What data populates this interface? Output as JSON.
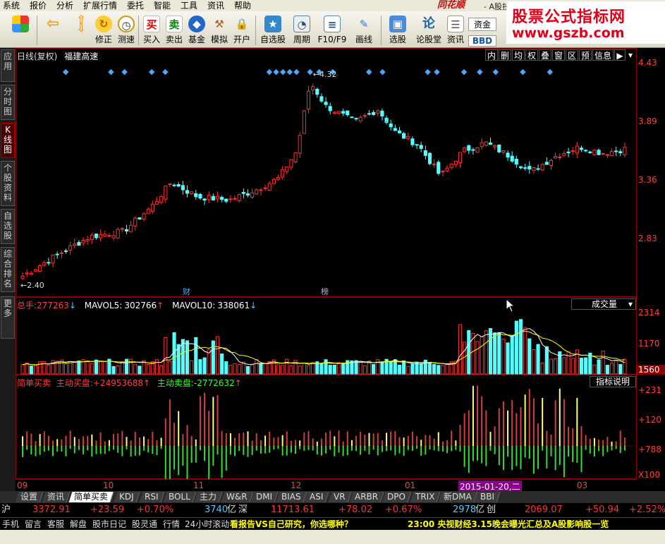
{
  "menu": [
    "系统",
    "报价",
    "分析",
    "扩展行情",
    "委托",
    "智能",
    "工具",
    "资讯",
    "帮助"
  ],
  "brand": "同花顺",
  "brand_sub": "- A股技",
  "watermark": {
    "line1": "股票公式指标网",
    "line2": "www.gszb.com"
  },
  "toolbar": [
    {
      "label": "",
      "icon": "grid-icon"
    },
    {
      "label": "",
      "icon": "back-arrow-icon"
    },
    {
      "label": "",
      "icon": "up-down-arrow-icon"
    },
    {
      "label": "修正",
      "icon": "refresh-icon"
    },
    {
      "label": "测速",
      "icon": "clock-icon"
    },
    {
      "label": "买入",
      "icon": "buy-icon",
      "glyph": "买"
    },
    {
      "label": "卖出",
      "icon": "sell-icon",
      "glyph": "卖"
    },
    {
      "label": "基金",
      "icon": "fund-icon"
    },
    {
      "label": "模拟",
      "icon": "hammer-icon"
    },
    {
      "label": "开户",
      "icon": "lock-icon"
    },
    {
      "label": "自选股",
      "icon": "star-icon"
    },
    {
      "label": "周期",
      "icon": "period-icon"
    },
    {
      "label": "F10/F9",
      "icon": "f10-icon"
    },
    {
      "label": "画线",
      "icon": "pencil-icon"
    },
    {
      "label": "选股",
      "icon": "screen-icon"
    },
    {
      "label": "论股堂",
      "icon": "forum-icon"
    },
    {
      "label": "资讯",
      "icon": "news-icon"
    },
    {
      "label": "资金",
      "icon": "fund-flow-icon"
    },
    {
      "label": "BBD",
      "icon": "bbd-icon"
    }
  ],
  "left_tabs": [
    "应用",
    "分时图",
    "K线图",
    "个股资料",
    "自选股",
    "综合排名",
    "更多"
  ],
  "active_left_tab": "K线图",
  "chart_header": {
    "period": "日线(复权)",
    "stock_name": "福建高速"
  },
  "period_tabs": [
    "内",
    "删",
    "均",
    "权",
    "叠",
    "窗",
    "区",
    "预",
    "信息"
  ],
  "price_axis": [
    "4.43",
    "3.89",
    "3.36",
    "2.83"
  ],
  "price_annotations": {
    "high": "4.32",
    "low": "2.40",
    "event1": "财",
    "event2": "榜"
  },
  "volume_header": {
    "total_label": "总手:",
    "total_value": "277263",
    "mavol5_label": "MAVOL5:",
    "mavol5_value": "302766",
    "mavol10_label": "MAVOL10:",
    "mavol10_value": "338061",
    "selector": "成交量"
  },
  "volume_axis": [
    "2314",
    "1170",
    "1560"
  ],
  "indicator_header": {
    "name": "简单买卖",
    "buy_label": "主动买盘:",
    "buy_value": "+24953688",
    "sell_label": "主动卖盘:",
    "sell_value": "-2772632",
    "help": "指标说明"
  },
  "indicator_axis": [
    "+231",
    "+120",
    "+788",
    "X100"
  ],
  "date_axis": [
    "09",
    "10",
    "11",
    "12",
    "01",
    "2015-01-20,二",
    "03"
  ],
  "indicator_tabs": [
    "设置",
    "资讯",
    "简单买卖",
    "KDJ",
    "RSI",
    "BOLL",
    "主力",
    "W&R",
    "DMI",
    "BIAS",
    "ASI",
    "VR",
    "ARBR",
    "DPO",
    "TRIX",
    "新DMA",
    "BBI"
  ],
  "selected_indicator": "简单买卖",
  "market": {
    "sh_label": "沪",
    "sh_index": "3372.91",
    "sh_change": "+23.59",
    "sh_pct": "+0.70%",
    "sh_amount": "3740",
    "unit": "亿",
    "sz_label": "深",
    "sz_index": "11713.61",
    "sz_change": "+78.02",
    "sz_pct": "+0.67%",
    "sz_amount": "2978",
    "cy_label": "创",
    "cy_index": "2069.07",
    "cy_change": "+50.94",
    "cy_pct": "+2.52%"
  },
  "ticker": {
    "buttons": [
      "手机",
      "留言",
      "客服",
      "解盘",
      "股市日记",
      "股灵通",
      "行情",
      "24小时滚动"
    ],
    "news1": "看报告VS自己研究，你选哪种？",
    "news2": "23:00 央视财经3.15晚会曝光汇总及A股影响股一览"
  },
  "colors": {
    "up": "#ff3232",
    "down": "#54ffff",
    "panel_border": "#8b0000",
    "axis_text": "#ff4040"
  }
}
